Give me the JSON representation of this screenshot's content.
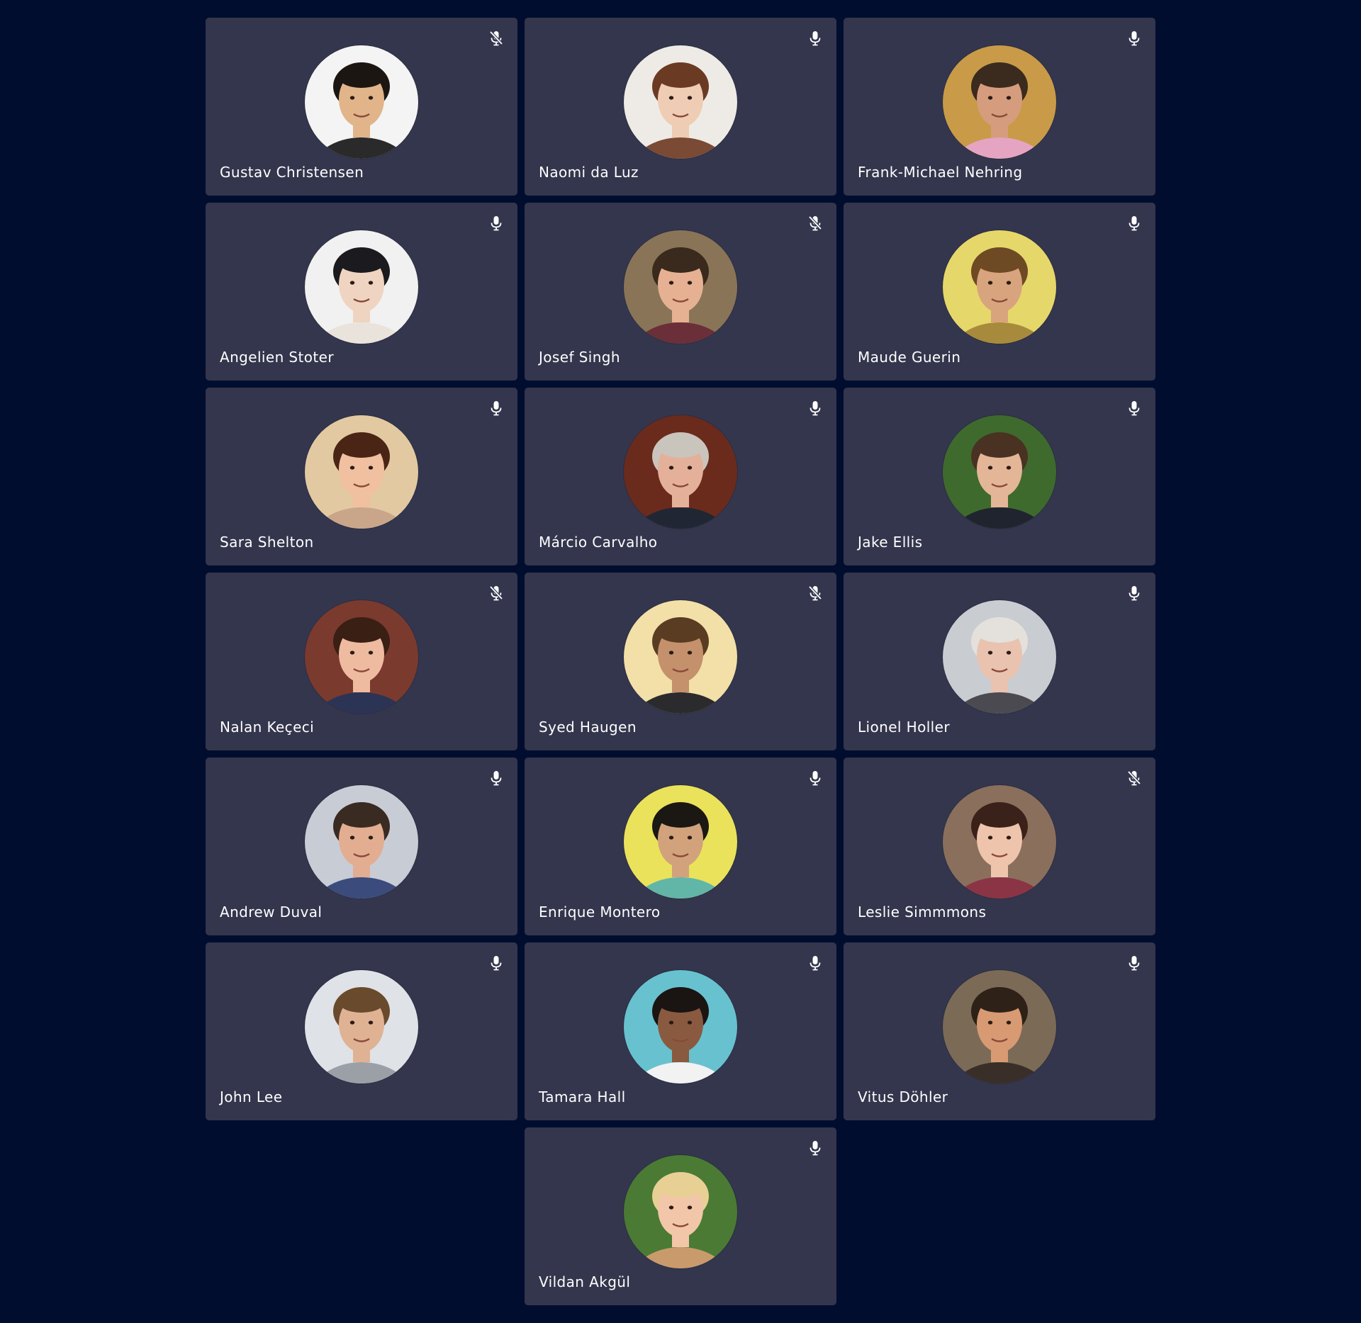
{
  "colors": {
    "background": "#000d2e",
    "tile": "#33364d",
    "name_text": "#ffffff",
    "icon": "#ffffff"
  },
  "participants": [
    {
      "name": "Gustav Christensen",
      "mic": "muted",
      "avatar": {
        "bg": "#f4f4f4",
        "skin": "#e2b48a",
        "hair": "#1c1612",
        "shirt": "#2a2a2a"
      }
    },
    {
      "name": "Naomi da Luz",
      "mic": "on",
      "avatar": {
        "bg": "#eeeae6",
        "skin": "#efcdb4",
        "hair": "#6b3a23",
        "shirt": "#7a4a34"
      }
    },
    {
      "name": "Frank-Michael Nehring",
      "mic": "on",
      "avatar": {
        "bg": "#c99a48",
        "skin": "#d59c7d",
        "hair": "#3b2a1e",
        "shirt": "#e5a5c2"
      }
    },
    {
      "name": "Angelien Stoter",
      "mic": "on",
      "avatar": {
        "bg": "#f1f1f1",
        "skin": "#f0d4c2",
        "hair": "#1b1b1f",
        "shirt": "#e9e3dc"
      }
    },
    {
      "name": "Josef Singh",
      "mic": "muted",
      "avatar": {
        "bg": "#8a7458",
        "skin": "#e6b193",
        "hair": "#3a2a1d",
        "shirt": "#6b2f3a"
      }
    },
    {
      "name": "Maude Guerin",
      "mic": "on",
      "avatar": {
        "bg": "#e6d76a",
        "skin": "#d8a47d",
        "hair": "#6d4a24",
        "shirt": "#a88a3c"
      }
    },
    {
      "name": "Sara Shelton",
      "mic": "on",
      "avatar": {
        "bg": "#e2c9a2",
        "skin": "#f0c0a0",
        "hair": "#4a2414",
        "shirt": "#c9a58a"
      }
    },
    {
      "name": "Márcio Carvalho",
      "mic": "on",
      "avatar": {
        "bg": "#6a2a1c",
        "skin": "#e5b09a",
        "hair": "#c9c4bc",
        "shirt": "#202633"
      }
    },
    {
      "name": "Jake Ellis",
      "mic": "on",
      "avatar": {
        "bg": "#3f6a2e",
        "skin": "#e4b698",
        "hair": "#4a3222",
        "shirt": "#20242e"
      }
    },
    {
      "name": "Nalan Keçeci",
      "mic": "muted",
      "avatar": {
        "bg": "#7a3a2e",
        "skin": "#eebba0",
        "hair": "#3a1f14",
        "shirt": "#2c3456"
      }
    },
    {
      "name": "Syed Haugen",
      "mic": "muted",
      "avatar": {
        "bg": "#f2e0a8",
        "skin": "#c4916c",
        "hair": "#5a3c22",
        "shirt": "#2b2b2e"
      }
    },
    {
      "name": "Lionel Holler",
      "mic": "on",
      "avatar": {
        "bg": "#c9ccd1",
        "skin": "#eac3b0",
        "hair": "#e4e1dd",
        "shirt": "#4a4a50"
      }
    },
    {
      "name": "Andrew Duval",
      "mic": "on",
      "avatar": {
        "bg": "#c8ccd4",
        "skin": "#e2ad90",
        "hair": "#3a2b22",
        "shirt": "#3b4b7c"
      }
    },
    {
      "name": "Enrique Montero",
      "mic": "on",
      "avatar": {
        "bg": "#e9e25a",
        "skin": "#d2a27c",
        "hair": "#1b1814",
        "shirt": "#62b6a8"
      }
    },
    {
      "name": "Leslie Simmmons",
      "mic": "muted",
      "avatar": {
        "bg": "#8a6f5c",
        "skin": "#efc4ad",
        "hair": "#3a221a",
        "shirt": "#8a3446"
      }
    },
    {
      "name": "John Lee",
      "mic": "on",
      "avatar": {
        "bg": "#dfe3e8",
        "skin": "#e0b294",
        "hair": "#6a4a2c",
        "shirt": "#9aa0a6"
      }
    },
    {
      "name": "Tamara Hall",
      "mic": "on",
      "avatar": {
        "bg": "#67c1cf",
        "skin": "#8a5a40",
        "hair": "#1a1412",
        "shirt": "#f2f2f2"
      }
    },
    {
      "name": "Vitus Döhler",
      "mic": "on",
      "avatar": {
        "bg": "#7a6a56",
        "skin": "#d79a72",
        "hair": "#2e2218",
        "shirt": "#3a2e28"
      }
    },
    {
      "name": "Vildan Akgül",
      "mic": "on",
      "avatar": {
        "bg": "#4a7a34",
        "skin": "#f2c6a8",
        "hair": "#e8cf94",
        "shirt": "#c89a6c"
      }
    }
  ]
}
